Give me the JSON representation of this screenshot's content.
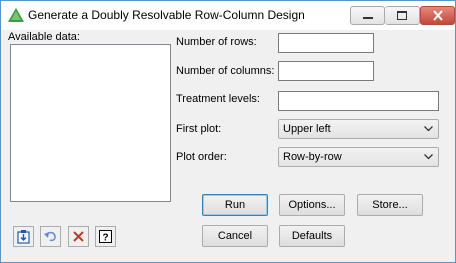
{
  "window": {
    "title": "Generate a Doubly Resolvable Row-Column Design",
    "app_icon": "triangle-app-icon",
    "title_buttons": [
      "minimize-icon",
      "maximize-icon",
      "close-icon"
    ]
  },
  "available_data": {
    "label": "Available data:",
    "items": []
  },
  "fields": {
    "rows": {
      "label": "Number of rows:",
      "value": ""
    },
    "columns": {
      "label": "Number of columns:",
      "value": ""
    },
    "treatment_levels": {
      "label": "Treatment levels:",
      "value": ""
    },
    "first_plot": {
      "label": "First plot:",
      "value": "Upper left"
    },
    "plot_order": {
      "label": "Plot order:",
      "value": "Row-by-row"
    }
  },
  "buttons": {
    "run": "Run",
    "options": "Options...",
    "store": "Store...",
    "cancel": "Cancel",
    "defaults": "Defaults"
  },
  "tool_icons": [
    "transfer-icon",
    "undo-icon",
    "clear-icon",
    "help-icon"
  ],
  "colors": {
    "title_accent": "#5a95c8",
    "default_button_border": "#3c7fb1",
    "close_button": "#c2473a",
    "clear_icon": "#c0392b"
  }
}
